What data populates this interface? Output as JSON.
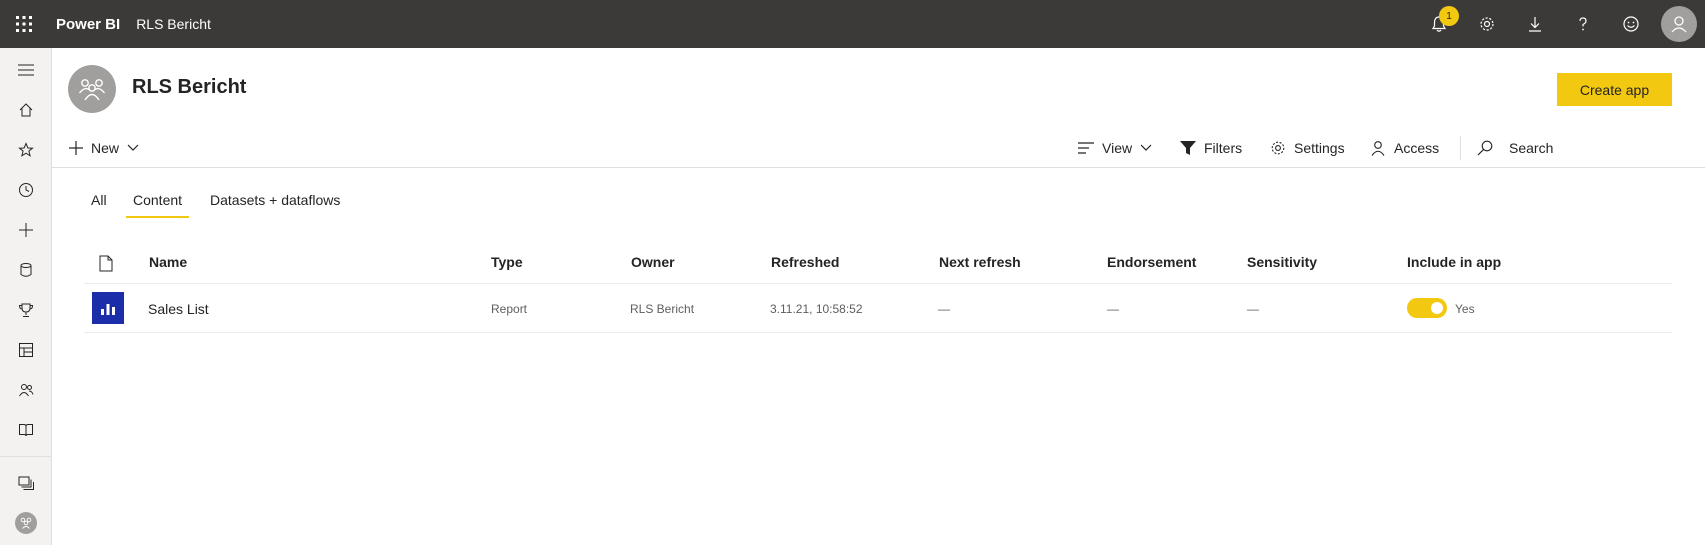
{
  "topbar": {
    "brand": "Power BI",
    "breadcrumb": "RLS Bericht",
    "notification_count": "1"
  },
  "header": {
    "workspace_title": "RLS Bericht",
    "create_app_label": "Create app"
  },
  "commandbar": {
    "new_label": "New",
    "view_label": "View",
    "filters_label": "Filters",
    "settings_label": "Settings",
    "access_label": "Access",
    "search_placeholder": "Search"
  },
  "tabs": [
    {
      "label": "All",
      "active": false
    },
    {
      "label": "Content",
      "active": true
    },
    {
      "label": "Datasets + dataflows",
      "active": false
    }
  ],
  "table": {
    "columns": [
      "Name",
      "Type",
      "Owner",
      "Refreshed",
      "Next refresh",
      "Endorsement",
      "Sensitivity",
      "Include in app"
    ],
    "rows": [
      {
        "name": "Sales List",
        "type": "Report",
        "owner": "RLS Bericht",
        "refreshed": "3.11.21, 10:58:52",
        "next_refresh": "—",
        "endorsement": "—",
        "sensitivity": "—",
        "include_in_app": "Yes"
      }
    ]
  },
  "colors": {
    "topbar_bg": "#3b3a39",
    "accent": "#f2c811",
    "report_icon_bg": "#1b2da8"
  }
}
